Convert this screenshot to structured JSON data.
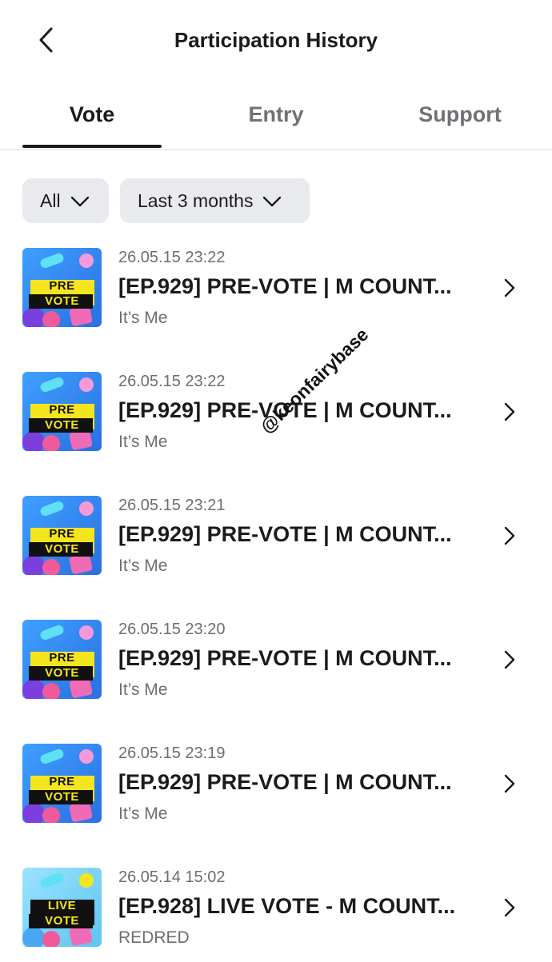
{
  "header": {
    "title": "Participation History",
    "back_icon": "chevron-left-icon"
  },
  "tabs": [
    {
      "label": "Vote",
      "active": true
    },
    {
      "label": "Entry",
      "active": false
    },
    {
      "label": "Support",
      "active": false
    }
  ],
  "filters": {
    "category": "All",
    "period": "Last 3 months"
  },
  "items": [
    {
      "date": "26.05.15 23:22",
      "title": "[EP.929] PRE-VOTE | M COUNT...",
      "subtitle": "It’s Me",
      "thumb": {
        "line1": "PRE",
        "line2": "VOTE",
        "kind": "pre-vote"
      }
    },
    {
      "date": "26.05.15 23:22",
      "title": "[EP.929] PRE-VOTE | M COUNT...",
      "subtitle": "It’s Me",
      "thumb": {
        "line1": "PRE",
        "line2": "VOTE",
        "kind": "pre-vote"
      }
    },
    {
      "date": "26.05.15 23:21",
      "title": "[EP.929] PRE-VOTE | M COUNT...",
      "subtitle": "It’s Me",
      "thumb": {
        "line1": "PRE",
        "line2": "VOTE",
        "kind": "pre-vote"
      }
    },
    {
      "date": "26.05.15 23:20",
      "title": "[EP.929] PRE-VOTE | M COUNT...",
      "subtitle": "It’s Me",
      "thumb": {
        "line1": "PRE",
        "line2": "VOTE",
        "kind": "pre-vote"
      }
    },
    {
      "date": "26.05.15 23:19",
      "title": "[EP.929] PRE-VOTE | M COUNT...",
      "subtitle": "It’s Me",
      "thumb": {
        "line1": "PRE",
        "line2": "VOTE",
        "kind": "pre-vote"
      }
    },
    {
      "date": "26.05.14 15:02",
      "title": "[EP.928] LIVE VOTE - M COUNT...",
      "subtitle": "REDRED",
      "thumb": {
        "line1": "LIVE",
        "line2": "VOTE",
        "kind": "live-vote"
      }
    }
  ],
  "watermark": "@keonfairybase",
  "colors": {
    "text": "#1b1b1d",
    "muted": "#6d6d72",
    "chip_bg": "#e9eaed",
    "divider": "#ececee",
    "thumb_yellow": "#f5e51f",
    "thumb_blue": "#2e88f0",
    "thumb_pink": "#f06bb6"
  }
}
